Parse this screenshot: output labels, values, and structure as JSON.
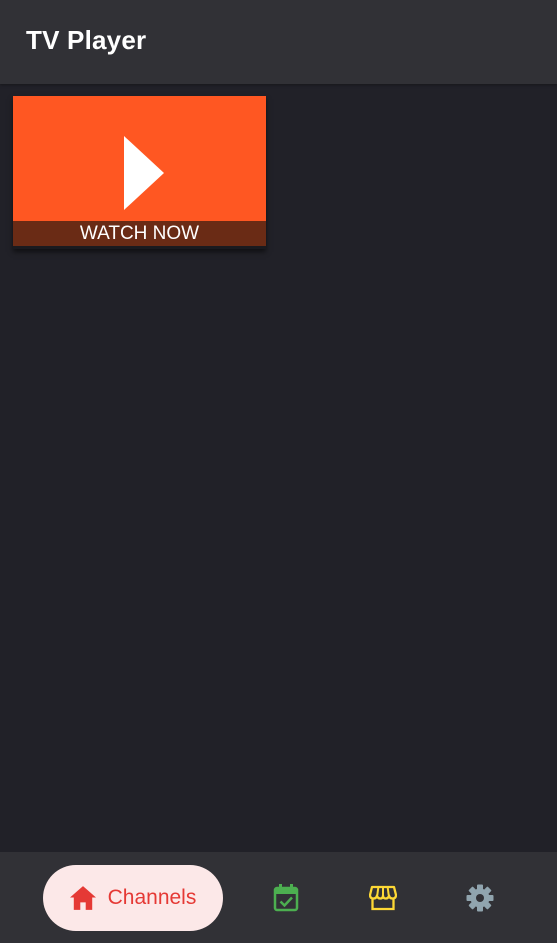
{
  "app": {
    "title": "TV Player"
  },
  "tile": {
    "caption": "WATCH NOW",
    "background_color": "#ff5722",
    "caption_background_color": "#6a2b15"
  },
  "bottom_nav": {
    "items": [
      {
        "label": "Channels",
        "icon": "home-icon",
        "active": true,
        "color": "#e53935"
      },
      {
        "label": "",
        "icon": "calendar-check-icon",
        "active": false,
        "color": "#4caf50"
      },
      {
        "label": "",
        "icon": "storefront-icon",
        "active": false,
        "color": "#fdd835"
      },
      {
        "label": "",
        "icon": "gear-icon",
        "active": false,
        "color": "#90a4ae"
      }
    ],
    "active_pill_color": "#fce8e8"
  },
  "colors": {
    "background": "#212128",
    "bars": "#313136"
  }
}
